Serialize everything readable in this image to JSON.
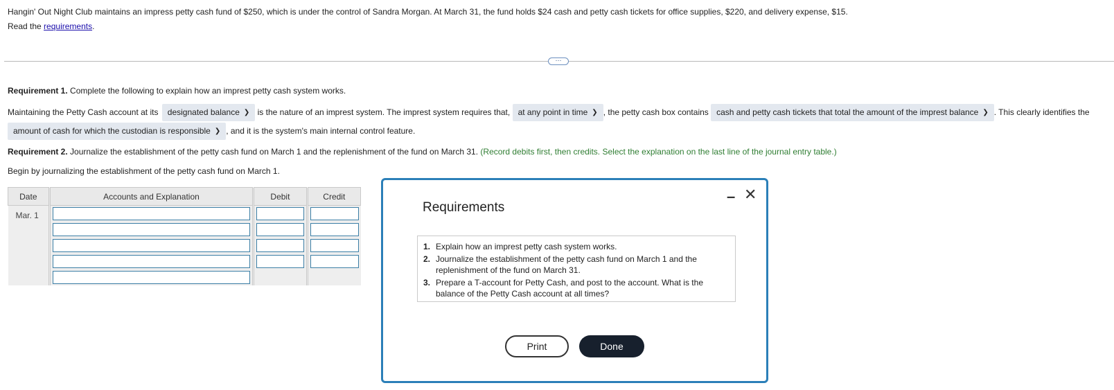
{
  "intro": {
    "problem_text": "Hangin' Out Night Club maintains an impress petty cash fund of $250, which is under the control of Sandra Morgan. At March 31, the fund holds $24 cash and petty cash tickets for office supplies, $220, and delivery expense, $15.",
    "read_prefix": "Read the ",
    "requirements_link": "requirements",
    "read_suffix": "."
  },
  "expander_label": "⋯",
  "req1": {
    "heading": "Requirement 1.",
    "text": " Complete the following to explain how an imprest petty cash system works.",
    "s_part1": "Maintaining the Petty Cash account at its",
    "dropdown1": "designated balance",
    "s_part2": "is the nature of an imprest system. The imprest system requires that,",
    "dropdown2": "at any point in time",
    "s_part3": ", the petty cash box contains",
    "dropdown3": "cash and petty cash tickets that total the amount of the imprest balance",
    "s_part4": ". This clearly identifies the",
    "dropdown4": "amount of cash for which the custodian is responsible",
    "s_part5": ", and it is the system's main internal control feature."
  },
  "req2": {
    "heading": "Requirement 2.",
    "text": " Journalize the establishment of the petty cash fund on March 1 and the replenishment of the fund on March 31.",
    "instruction": "(Record debits first, then credits. Select the explanation on the last line of the journal entry table.)",
    "begin_text": "Begin by journalizing the establishment of the petty cash fund on March 1."
  },
  "journal": {
    "headers": [
      "Date",
      "Accounts and Explanation",
      "Debit",
      "Credit"
    ],
    "date": "Mar. 1"
  },
  "modal": {
    "title": "Requirements",
    "items": [
      {
        "num": "1.",
        "text": "Explain how an imprest petty cash system works."
      },
      {
        "num": "2.",
        "text": "Journalize the establishment of the petty cash fund on March 1 and the replenishment of the fund on March 31."
      },
      {
        "num": "3.",
        "text": "Prepare a T-account for Petty Cash, and post to the account. What is the balance of the Petty Cash account at all times?"
      }
    ],
    "print_label": "Print",
    "done_label": "Done",
    "minimize_icon": "minimize-icon",
    "close_icon": "close-icon"
  }
}
